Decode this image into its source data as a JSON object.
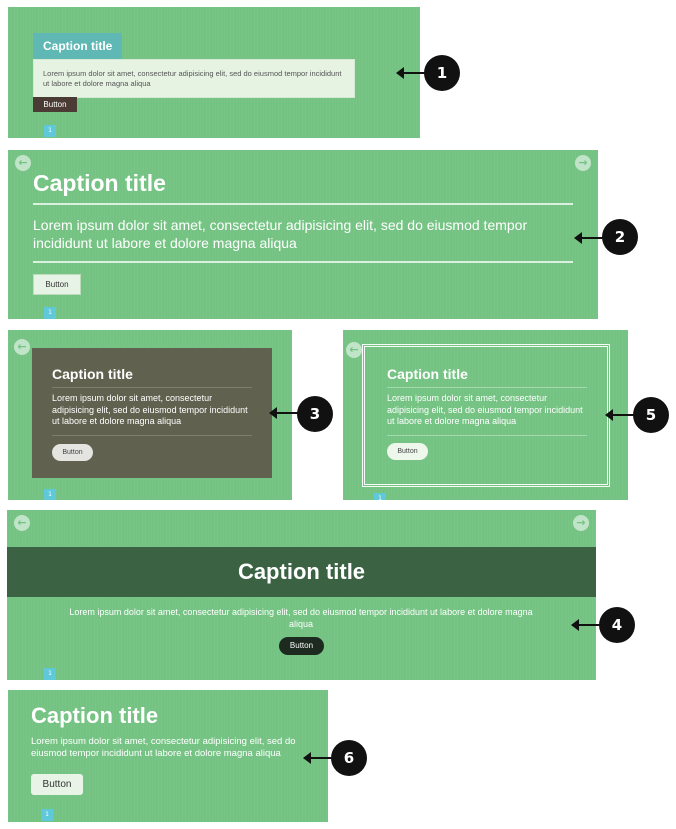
{
  "caption": {
    "title": "Caption title",
    "body": "Lorem ipsum dolor sit amet, consectetur adipisicing elit, sed do eiusmod tempor incididunt ut labore et dolore magna aliqua",
    "button": "Button"
  },
  "pager": {
    "current": "1"
  },
  "nav": {
    "prev_icon": "arrow-left-icon",
    "next_icon": "arrow-right-icon"
  },
  "callouts": {
    "one": "1",
    "two": "2",
    "three": "3",
    "four": "4",
    "five": "5",
    "six": "6"
  },
  "colors": {
    "slide_bg": "#74c383",
    "pager": "#5fc8d9",
    "title_tab": "#5fb8b4",
    "dark_band": "#3b6343",
    "dark_box": "#60624f"
  }
}
